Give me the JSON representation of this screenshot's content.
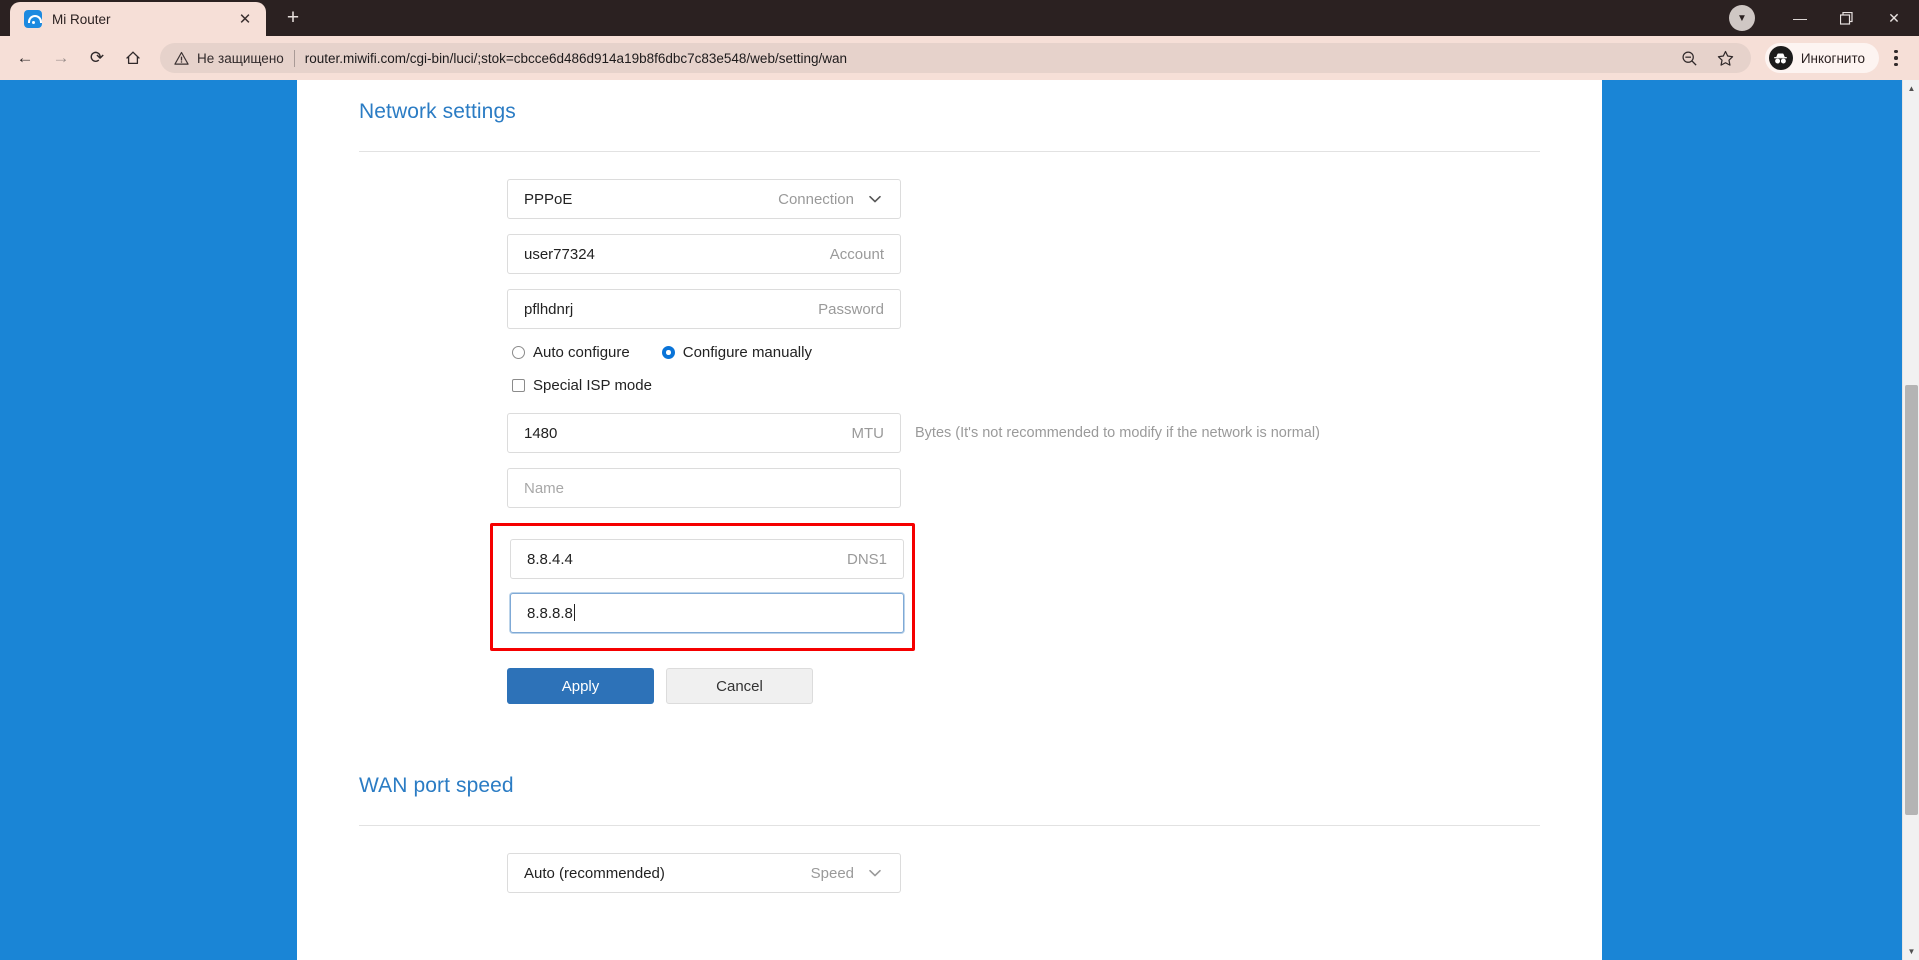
{
  "browser": {
    "tab": {
      "title": "Mi Router",
      "favicon": "wifi-icon",
      "close": "✕"
    },
    "new_tab": "+",
    "window_controls": {
      "download": "▼",
      "minimize": "—",
      "maximize": "❐",
      "close": "✕"
    },
    "toolbar": {
      "back": "←",
      "forward": "→",
      "reload": "⟳",
      "home": "⌂",
      "not_secure": "Не защищено",
      "url": "router.miwifi.com/cgi-bin/luci/;stok=cbcce6d486d914a19b8f6dbc7c83e548/web/setting/wan",
      "zoom": "⊖",
      "bookmark": "☆",
      "profile_label": "Инкогнито",
      "menu": "⋮"
    }
  },
  "page": {
    "background_color": "#1a85d6",
    "network_settings": {
      "title": "Network settings",
      "connection": {
        "value": "PPPoE",
        "label": "Connection",
        "caret": "chevron-down-icon"
      },
      "account": {
        "value": "user77324",
        "label": "Account"
      },
      "password": {
        "value": "pflhdnrj",
        "label": "Password"
      },
      "config_mode": {
        "auto": "Auto configure",
        "manual": "Configure manually",
        "selected": "manual"
      },
      "special_isp": {
        "label": "Special ISP mode",
        "checked": false
      },
      "mtu": {
        "value": "1480",
        "label": "MTU",
        "hint": "Bytes (It's not recommended to modify if the network is normal)"
      },
      "name": {
        "value": "",
        "placeholder": "Name"
      },
      "dns1": {
        "value": "8.8.4.4",
        "label": "DNS1"
      },
      "dns2": {
        "value": "8.8.8.8",
        "label": "",
        "focused": true
      },
      "highlight_color": "#f50000",
      "apply": "Apply",
      "cancel": "Cancel"
    },
    "wan_port_speed": {
      "title": "WAN port speed",
      "speed": {
        "value": "Auto (recommended)",
        "label": "Speed",
        "caret": "chevron-down-icon"
      }
    }
  }
}
